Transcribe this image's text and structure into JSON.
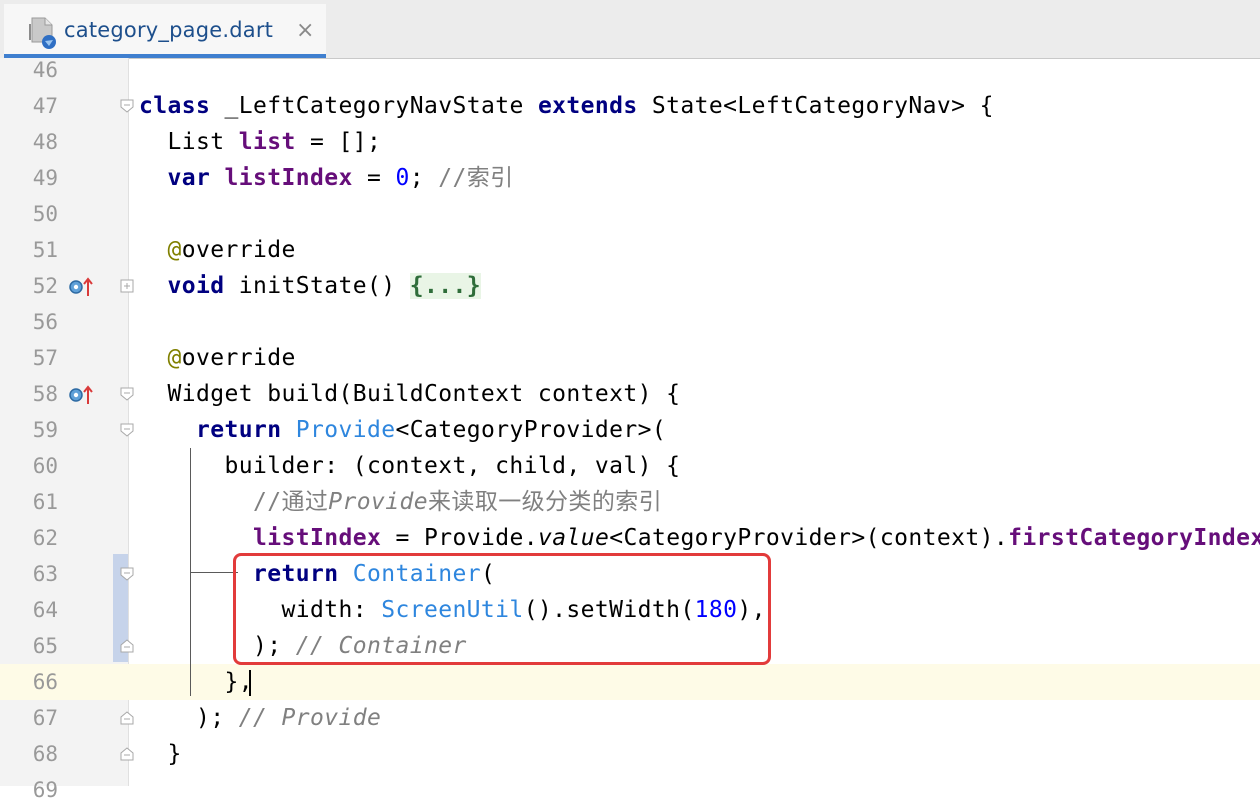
{
  "tab": {
    "filename": "category_page.dart",
    "close_glyph": "×",
    "icon": "dart-file-icon"
  },
  "colors": {
    "keyword": "#000080",
    "field": "#660e7a",
    "number": "#0000ff",
    "comment": "#808080",
    "annotation": "#808000",
    "class_ref": "#2e86de",
    "highlight_box": "#e23b3b",
    "current_line": "#fefbe7"
  },
  "lines": [
    {
      "num": "46",
      "tokens": []
    },
    {
      "num": "47",
      "tokens": [
        {
          "t": "class",
          "c": "kw"
        },
        {
          "t": " _LeftCategoryNavState "
        },
        {
          "t": "extends",
          "c": "kw"
        },
        {
          "t": " State<LeftCategoryNav> {"
        }
      ]
    },
    {
      "num": "48",
      "tokens": [
        {
          "t": "  List "
        },
        {
          "t": "list",
          "c": "field"
        },
        {
          "t": " = [];"
        }
      ]
    },
    {
      "num": "49",
      "tokens": [
        {
          "t": "  "
        },
        {
          "t": "var",
          "c": "kw"
        },
        {
          "t": " "
        },
        {
          "t": "listIndex",
          "c": "field"
        },
        {
          "t": " = "
        },
        {
          "t": "0",
          "c": "num-lit"
        },
        {
          "t": "; "
        },
        {
          "t": "//索引",
          "c": "comment"
        }
      ]
    },
    {
      "num": "50",
      "tokens": []
    },
    {
      "num": "51",
      "tokens": [
        {
          "t": "  "
        },
        {
          "t": "@",
          "c": "annot"
        },
        {
          "t": "override"
        }
      ]
    },
    {
      "num": "52",
      "tokens": [
        {
          "t": "  "
        },
        {
          "t": "void",
          "c": "kw"
        },
        {
          "t": " initState() "
        },
        {
          "t": "{...}",
          "c": "folded"
        }
      ]
    },
    {
      "num": "56",
      "tokens": []
    },
    {
      "num": "57",
      "tokens": [
        {
          "t": "  "
        },
        {
          "t": "@",
          "c": "annot"
        },
        {
          "t": "override"
        }
      ]
    },
    {
      "num": "58",
      "tokens": [
        {
          "t": "  Widget build(BuildContext context) {"
        }
      ]
    },
    {
      "num": "59",
      "tokens": [
        {
          "t": "    "
        },
        {
          "t": "return",
          "c": "kw"
        },
        {
          "t": " "
        },
        {
          "t": "Provide",
          "c": "cls"
        },
        {
          "t": "<CategoryProvider>("
        }
      ]
    },
    {
      "num": "60",
      "tokens": [
        {
          "t": "      builder: (context, child, val) {"
        }
      ]
    },
    {
      "num": "61",
      "tokens": [
        {
          "t": "        "
        },
        {
          "t": "//通过",
          "c": "comment"
        },
        {
          "t": "Provide",
          "c": "comment ital"
        },
        {
          "t": "来读取一级分类的索引",
          "c": "comment"
        }
      ]
    },
    {
      "num": "62",
      "tokens": [
        {
          "t": "        "
        },
        {
          "t": "listIndex",
          "c": "field"
        },
        {
          "t": " = Provide."
        },
        {
          "t": "value",
          "c": "ital"
        },
        {
          "t": "<CategoryProvider>(context)."
        },
        {
          "t": "firstCategoryIndex",
          "c": "field"
        },
        {
          "t": ";"
        }
      ]
    },
    {
      "num": "63",
      "tokens": [
        {
          "t": "        "
        },
        {
          "t": "return",
          "c": "kw"
        },
        {
          "t": " "
        },
        {
          "t": "Container",
          "c": "cls"
        },
        {
          "t": "("
        }
      ]
    },
    {
      "num": "64",
      "tokens": [
        {
          "t": "          width: "
        },
        {
          "t": "ScreenUtil",
          "c": "cls"
        },
        {
          "t": "().setWidth("
        },
        {
          "t": "180",
          "c": "num-lit"
        },
        {
          "t": "),"
        }
      ]
    },
    {
      "num": "65",
      "tokens": [
        {
          "t": "        ); "
        },
        {
          "t": "// Container",
          "c": "comment ital"
        }
      ]
    },
    {
      "num": "66",
      "tokens": [
        {
          "t": "      },"
        }
      ]
    },
    {
      "num": "67",
      "tokens": [
        {
          "t": "    ); "
        },
        {
          "t": "// Provide",
          "c": "comment ital"
        }
      ]
    },
    {
      "num": "68",
      "tokens": [
        {
          "t": "  }"
        }
      ]
    },
    {
      "num": "69",
      "tokens": []
    }
  ]
}
